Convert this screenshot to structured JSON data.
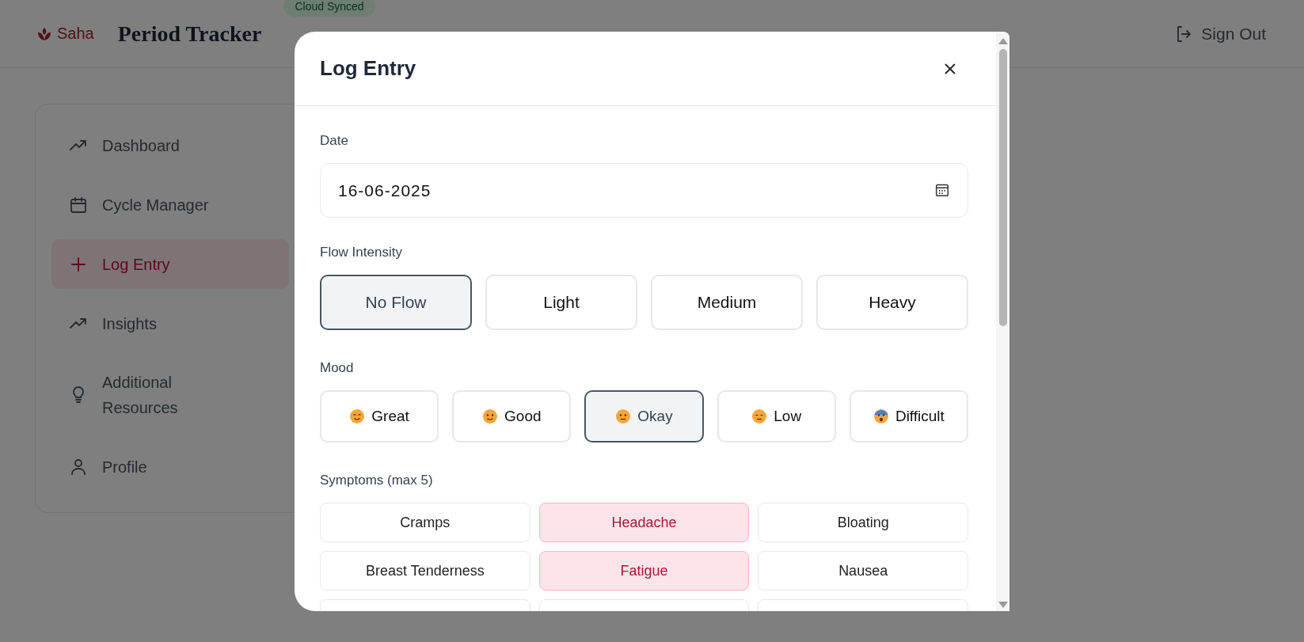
{
  "header": {
    "logo": "Saha",
    "title": "Period Tracker",
    "badge": "Cloud Synced",
    "sign_out": "Sign Out"
  },
  "sidebar": {
    "items": [
      {
        "label": "Dashboard",
        "selected": false
      },
      {
        "label": "Cycle Manager",
        "selected": false
      },
      {
        "label": "Log Entry",
        "selected": true
      },
      {
        "label": "Insights",
        "selected": false
      },
      {
        "label": "Additional Resources",
        "selected": false
      },
      {
        "label": "Profile",
        "selected": false
      }
    ]
  },
  "modal": {
    "title": "Log Entry",
    "date": {
      "label": "Date",
      "value": "16-06-2025"
    },
    "flow": {
      "label": "Flow Intensity",
      "options": [
        {
          "label": "No Flow",
          "selected": true
        },
        {
          "label": "Light",
          "selected": false
        },
        {
          "label": "Medium",
          "selected": false
        },
        {
          "label": "Heavy",
          "selected": false
        }
      ]
    },
    "mood": {
      "label": "Mood",
      "options": [
        {
          "label": "Great",
          "selected": false
        },
        {
          "label": "Good",
          "selected": false
        },
        {
          "label": "Okay",
          "selected": true
        },
        {
          "label": "Low",
          "selected": false
        },
        {
          "label": "Difficult",
          "selected": false
        }
      ]
    },
    "symptoms": {
      "label": "Symptoms (max 5)",
      "options": [
        {
          "label": "Cramps",
          "selected": false
        },
        {
          "label": "Headache",
          "selected": true
        },
        {
          "label": "Bloating",
          "selected": false
        },
        {
          "label": "Breast Tenderness",
          "selected": false
        },
        {
          "label": "Fatigue",
          "selected": true
        },
        {
          "label": "Nausea",
          "selected": false
        },
        {
          "selected": false
        },
        {
          "selected": false
        },
        {
          "selected": false
        }
      ]
    }
  }
}
